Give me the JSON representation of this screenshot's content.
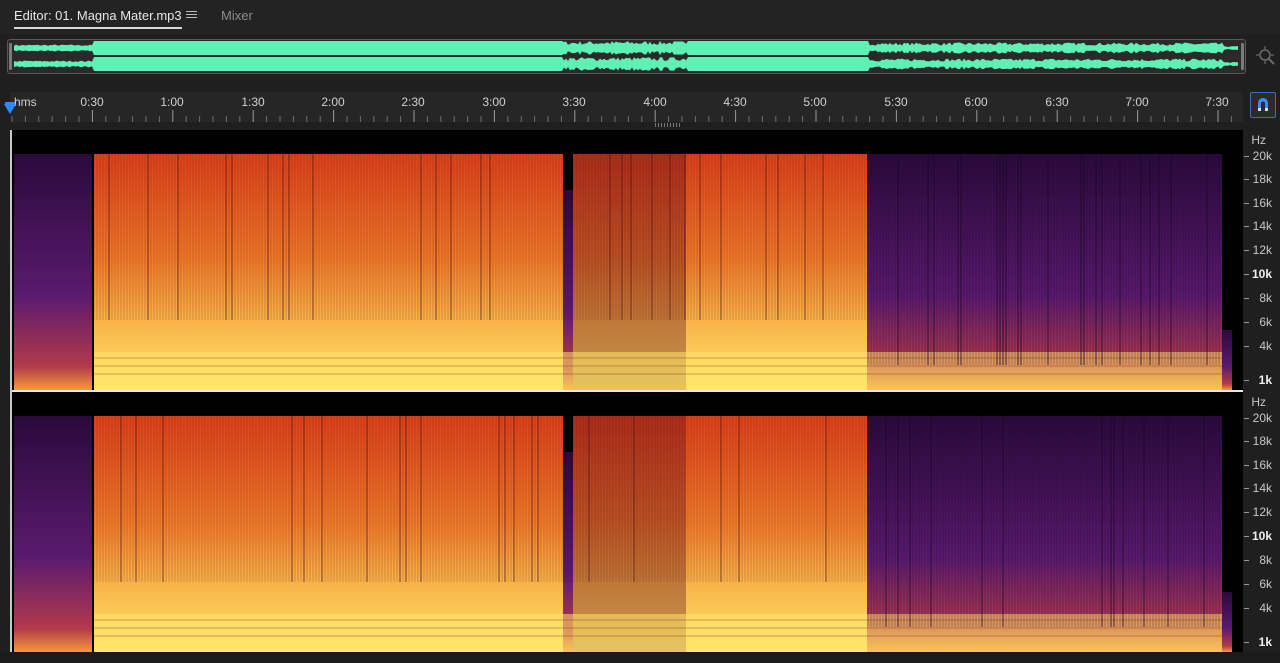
{
  "tabs": {
    "editor_label": "Editor: 01. Magna Mater.mp3",
    "mixer_label": "Mixer"
  },
  "icons": {
    "tab_menu": "hamburger-menu-icon",
    "zoom": "zoom-navigator-icon",
    "snap": "magnet-snap-icon",
    "playhead": "playhead-marker-icon"
  },
  "colors": {
    "waveform": "#5ff0b4",
    "playhead": "#2e8bff",
    "ruler_text": "#d0d0d0",
    "spectrogram_low": "#ffe66b",
    "spectrogram_mid": "#e8451c",
    "spectrogram_high": "#5a1a6e"
  },
  "ruler": {
    "unit": "hms",
    "labels": [
      "0:30",
      "1:00",
      "1:30",
      "2:00",
      "2:30",
      "3:00",
      "3:30",
      "4:00",
      "4:30",
      "5:00",
      "5:30",
      "6:00",
      "6:30",
      "7:00",
      "7:30"
    ]
  },
  "frequency_axis": {
    "unit": "Hz",
    "labels": [
      "20k",
      "18k",
      "16k",
      "14k",
      "12k",
      "10k",
      "8k",
      "6k",
      "4k",
      "1k"
    ],
    "bold_labels": [
      "10k",
      "1k"
    ]
  }
}
